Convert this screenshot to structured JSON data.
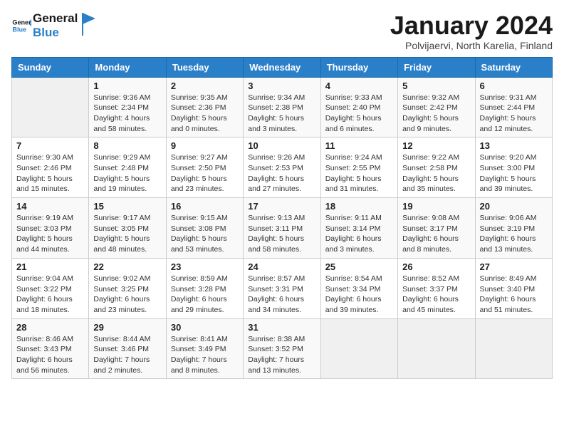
{
  "logo": {
    "text_general": "General",
    "text_blue": "Blue"
  },
  "title": "January 2024",
  "location": "Polvijaervi, North Karelia, Finland",
  "days_of_week": [
    "Sunday",
    "Monday",
    "Tuesday",
    "Wednesday",
    "Thursday",
    "Friday",
    "Saturday"
  ],
  "weeks": [
    [
      {
        "num": "",
        "info": ""
      },
      {
        "num": "1",
        "info": "Sunrise: 9:36 AM\nSunset: 2:34 PM\nDaylight: 4 hours\nand 58 minutes."
      },
      {
        "num": "2",
        "info": "Sunrise: 9:35 AM\nSunset: 2:36 PM\nDaylight: 5 hours\nand 0 minutes."
      },
      {
        "num": "3",
        "info": "Sunrise: 9:34 AM\nSunset: 2:38 PM\nDaylight: 5 hours\nand 3 minutes."
      },
      {
        "num": "4",
        "info": "Sunrise: 9:33 AM\nSunset: 2:40 PM\nDaylight: 5 hours\nand 6 minutes."
      },
      {
        "num": "5",
        "info": "Sunrise: 9:32 AM\nSunset: 2:42 PM\nDaylight: 5 hours\nand 9 minutes."
      },
      {
        "num": "6",
        "info": "Sunrise: 9:31 AM\nSunset: 2:44 PM\nDaylight: 5 hours\nand 12 minutes."
      }
    ],
    [
      {
        "num": "7",
        "info": "Sunrise: 9:30 AM\nSunset: 2:46 PM\nDaylight: 5 hours\nand 15 minutes."
      },
      {
        "num": "8",
        "info": "Sunrise: 9:29 AM\nSunset: 2:48 PM\nDaylight: 5 hours\nand 19 minutes."
      },
      {
        "num": "9",
        "info": "Sunrise: 9:27 AM\nSunset: 2:50 PM\nDaylight: 5 hours\nand 23 minutes."
      },
      {
        "num": "10",
        "info": "Sunrise: 9:26 AM\nSunset: 2:53 PM\nDaylight: 5 hours\nand 27 minutes."
      },
      {
        "num": "11",
        "info": "Sunrise: 9:24 AM\nSunset: 2:55 PM\nDaylight: 5 hours\nand 31 minutes."
      },
      {
        "num": "12",
        "info": "Sunrise: 9:22 AM\nSunset: 2:58 PM\nDaylight: 5 hours\nand 35 minutes."
      },
      {
        "num": "13",
        "info": "Sunrise: 9:20 AM\nSunset: 3:00 PM\nDaylight: 5 hours\nand 39 minutes."
      }
    ],
    [
      {
        "num": "14",
        "info": "Sunrise: 9:19 AM\nSunset: 3:03 PM\nDaylight: 5 hours\nand 44 minutes."
      },
      {
        "num": "15",
        "info": "Sunrise: 9:17 AM\nSunset: 3:05 PM\nDaylight: 5 hours\nand 48 minutes."
      },
      {
        "num": "16",
        "info": "Sunrise: 9:15 AM\nSunset: 3:08 PM\nDaylight: 5 hours\nand 53 minutes."
      },
      {
        "num": "17",
        "info": "Sunrise: 9:13 AM\nSunset: 3:11 PM\nDaylight: 5 hours\nand 58 minutes."
      },
      {
        "num": "18",
        "info": "Sunrise: 9:11 AM\nSunset: 3:14 PM\nDaylight: 6 hours\nand 3 minutes."
      },
      {
        "num": "19",
        "info": "Sunrise: 9:08 AM\nSunset: 3:17 PM\nDaylight: 6 hours\nand 8 minutes."
      },
      {
        "num": "20",
        "info": "Sunrise: 9:06 AM\nSunset: 3:19 PM\nDaylight: 6 hours\nand 13 minutes."
      }
    ],
    [
      {
        "num": "21",
        "info": "Sunrise: 9:04 AM\nSunset: 3:22 PM\nDaylight: 6 hours\nand 18 minutes."
      },
      {
        "num": "22",
        "info": "Sunrise: 9:02 AM\nSunset: 3:25 PM\nDaylight: 6 hours\nand 23 minutes."
      },
      {
        "num": "23",
        "info": "Sunrise: 8:59 AM\nSunset: 3:28 PM\nDaylight: 6 hours\nand 29 minutes."
      },
      {
        "num": "24",
        "info": "Sunrise: 8:57 AM\nSunset: 3:31 PM\nDaylight: 6 hours\nand 34 minutes."
      },
      {
        "num": "25",
        "info": "Sunrise: 8:54 AM\nSunset: 3:34 PM\nDaylight: 6 hours\nand 39 minutes."
      },
      {
        "num": "26",
        "info": "Sunrise: 8:52 AM\nSunset: 3:37 PM\nDaylight: 6 hours\nand 45 minutes."
      },
      {
        "num": "27",
        "info": "Sunrise: 8:49 AM\nSunset: 3:40 PM\nDaylight: 6 hours\nand 51 minutes."
      }
    ],
    [
      {
        "num": "28",
        "info": "Sunrise: 8:46 AM\nSunset: 3:43 PM\nDaylight: 6 hours\nand 56 minutes."
      },
      {
        "num": "29",
        "info": "Sunrise: 8:44 AM\nSunset: 3:46 PM\nDaylight: 7 hours\nand 2 minutes."
      },
      {
        "num": "30",
        "info": "Sunrise: 8:41 AM\nSunset: 3:49 PM\nDaylight: 7 hours\nand 8 minutes."
      },
      {
        "num": "31",
        "info": "Sunrise: 8:38 AM\nSunset: 3:52 PM\nDaylight: 7 hours\nand 13 minutes."
      },
      {
        "num": "",
        "info": ""
      },
      {
        "num": "",
        "info": ""
      },
      {
        "num": "",
        "info": ""
      }
    ]
  ]
}
